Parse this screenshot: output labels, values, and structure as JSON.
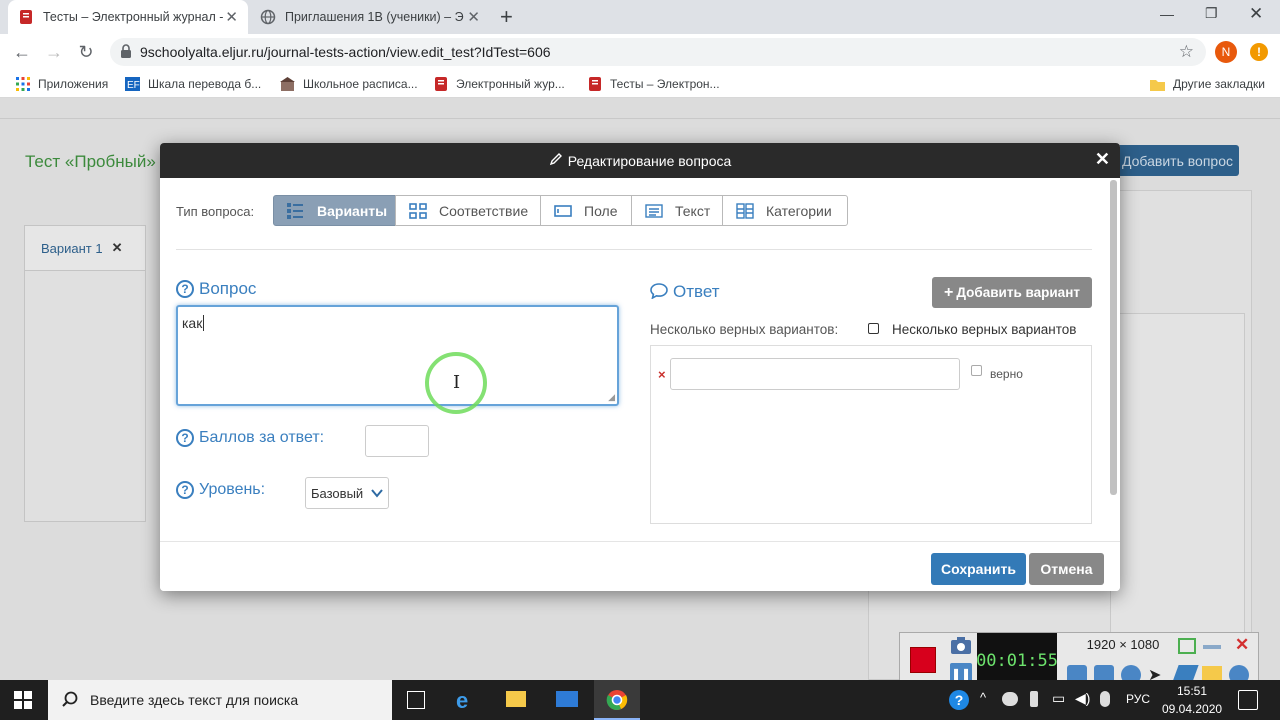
{
  "browser": {
    "tabs": [
      {
        "title": "Тесты  – Электронный журнал - ",
        "active": true
      },
      {
        "title": "Приглашения 1В (ученики) – Э",
        "active": false
      }
    ],
    "new_tab": "+",
    "url": "9schoolyalta.eljur.ru/journal-tests-action/view.edit_test?IdTest=606",
    "profile_initial": "N",
    "bookmarks": [
      {
        "label": "Приложения",
        "icon": "apps-grid-icon"
      },
      {
        "label": "Шкала перевода б...",
        "icon": "translate-icon"
      },
      {
        "label": "Школьное расписа...",
        "icon": "school-icon"
      },
      {
        "label": "Электронный жур...",
        "icon": "journal-icon"
      },
      {
        "label": "Тесты  – Электрон...",
        "icon": "journal-icon"
      }
    ],
    "other_bookmarks": "Другие закладки"
  },
  "background_page": {
    "test_title": "Тест «Пробный»",
    "add_question_button": "Добавить вопрос",
    "variant_tab": "Вариант 1"
  },
  "modal": {
    "title": "Редактирование вопроса",
    "type_label": "Тип вопроса:",
    "types": [
      {
        "label": "Варианты",
        "active": true
      },
      {
        "label": "Соответствие",
        "active": false
      },
      {
        "label": "Поле",
        "active": false
      },
      {
        "label": "Текст",
        "active": false
      },
      {
        "label": "Категории",
        "active": false
      }
    ],
    "question_label": "Вопрос",
    "question_value": "как",
    "score_label": "Баллов за ответ:",
    "score_value": "",
    "level_label": "Уровень:",
    "level_value": "Базовый",
    "answer_label": "Ответ",
    "add_variant_button": "Добавить вариант",
    "multiple_label": "Несколько верных вариантов:",
    "multiple_checkbox_label": "Несколько верных вариантов",
    "variant_correct_label": "верно",
    "variant_value": "",
    "save_button": "Сохранить",
    "cancel_button": "Отмена"
  },
  "recorder": {
    "time": "00:01:55",
    "resolution": "1920 × 1080"
  },
  "taskbar": {
    "search_placeholder": "Введите здесь текст для поиска",
    "lang": "РУС",
    "time": "15:51",
    "date": "09.04.2020"
  },
  "colors": {
    "primary": "#337ab7",
    "secondary": "#888888",
    "modal_header": "#2a2a2a",
    "accent_green": "#3c8a3c"
  }
}
